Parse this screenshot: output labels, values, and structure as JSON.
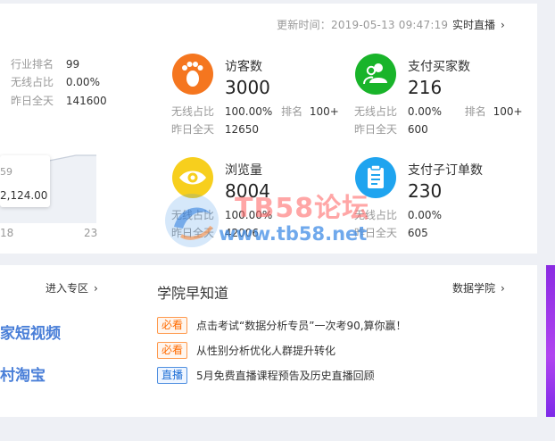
{
  "header": {
    "updated_text": "更新时间：2019-05-13 09:47:19",
    "live_link": "实时直播",
    "chevron": "chevron-right-icon"
  },
  "left_stats": [
    {
      "label": "行业排名",
      "value": "99"
    },
    {
      "label": "无线占比",
      "value": "0.00%"
    },
    {
      "label": "昨日全天",
      "value": "141600"
    }
  ],
  "chart": {
    "tooltip_line1": "59",
    "tooltip_line2": "2,124.00",
    "x_labels": [
      "18",
      "23"
    ]
  },
  "stats": [
    {
      "icon": "footprint-icon",
      "color": "#f5761f",
      "title": "访客数",
      "value": "3000",
      "wireless_label": "无线占比",
      "wireless_value": "100.00%",
      "rank_label": "排名",
      "rank_value": "100+",
      "yday_label": "昨日全天",
      "yday_value": "12650"
    },
    {
      "icon": "users-icon",
      "color": "#19b42a",
      "title": "支付买家数",
      "value": "216",
      "wireless_label": "无线占比",
      "wireless_value": "0.00%",
      "rank_label": "排名",
      "rank_value": "100+",
      "yday_label": "昨日全天",
      "yday_value": "600"
    },
    {
      "icon": "eye-icon",
      "color": "#f7cf1d",
      "title": "浏览量",
      "value": "8004",
      "wireless_label": "无线占比",
      "wireless_value": "100.00%",
      "yday_label": "昨日全天",
      "yday_value": "42006"
    },
    {
      "icon": "clipboard-icon",
      "color": "#1fa4ef",
      "title": "支付子订单数",
      "value": "230",
      "wireless_label": "无线占比",
      "wireless_value": "0.00%",
      "yday_label": "昨日全天",
      "yday_value": "605"
    }
  ],
  "watermark": {
    "line1": "TB58论坛",
    "line2": "www.tb58.net"
  },
  "bottom": {
    "enter_zone": "进入专区",
    "links": [
      "家短视频",
      "村淘宝"
    ],
    "academy_title": "学院早知道",
    "academy_link": "数据学院",
    "news": [
      {
        "tag": "必看",
        "tag_color": "orange",
        "text": "点击考试“数据分析专员”一次考90,算你赢！"
      },
      {
        "tag": "必看",
        "tag_color": "orange",
        "text": "从性别分析优化人群提升转化"
      },
      {
        "tag": "直播",
        "tag_color": "blue",
        "text": "5月免费直播课程预告及历史直播回顾"
      }
    ]
  }
}
